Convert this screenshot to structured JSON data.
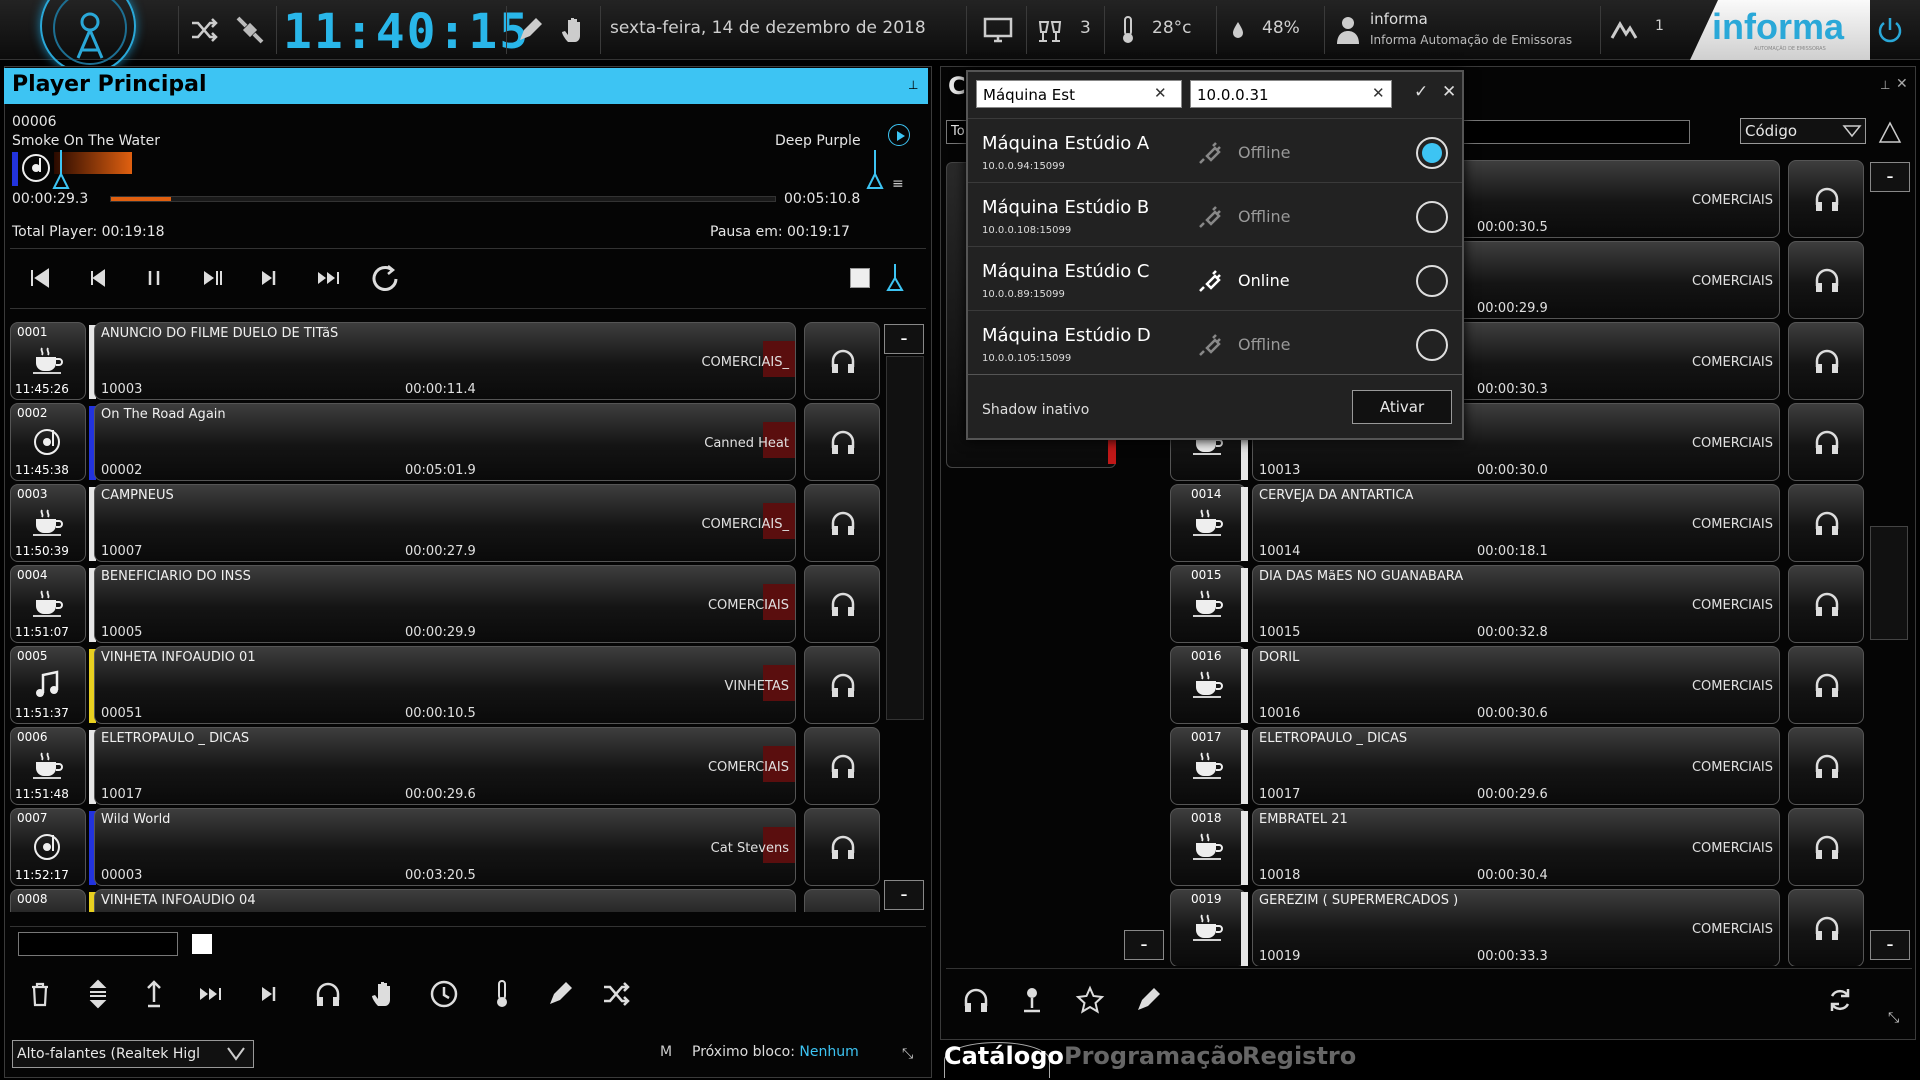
{
  "topbar": {
    "clock": "11:40:15",
    "date": "sexta-feira, 14 de dezembro de 2018",
    "alerts_count": "3",
    "temperature": "28°c",
    "humidity": "48%",
    "user_name": "informa",
    "user_company": "Informa Automação de Emissoras",
    "signal_count": "1",
    "brand_name": "informa",
    "brand_tagline": "AUTOMAÇÃO DE EMISSORAS"
  },
  "player": {
    "title": "Player Principal",
    "track_number": "00006",
    "track_title": "Smoke On The Water",
    "track_artist": "Deep Purple",
    "elapsed": "00:00:29.3",
    "remaining": "00:05:10.8",
    "total_label": "Total Player:",
    "total_value": "00:19:18",
    "pause_label": "Pausa em:",
    "pause_value": "00:19:17",
    "progress": 0.09
  },
  "queue": [
    {
      "num": "0001",
      "time": "11:45:26",
      "title": "ANUNCIO DO FILME DUELO DE TITãS",
      "code": "10003",
      "dur": "00:00:11.4",
      "cat": "COMERCIAIS_",
      "icon": "coffee",
      "bar": "#e6e6e6"
    },
    {
      "num": "0002",
      "time": "11:45:38",
      "title": "On The Road Again",
      "code": "00002",
      "dur": "00:05:01.9",
      "cat": "Canned Heat",
      "icon": "music-disc",
      "bar": "#2233dd"
    },
    {
      "num": "0003",
      "time": "11:50:39",
      "title": "CAMPNEUS",
      "code": "10007",
      "dur": "00:00:27.9",
      "cat": "COMERCIAIS_",
      "icon": "coffee",
      "bar": "#e6e6e6"
    },
    {
      "num": "0004",
      "time": "11:51:07",
      "title": "BENEFICIARIO DO INSS",
      "code": "10005",
      "dur": "00:00:29.9",
      "cat": "COMERCIAIS",
      "icon": "coffee",
      "bar": "#e6e6e6"
    },
    {
      "num": "0005",
      "time": "11:51:37",
      "title": "VINHETA INFOAUDIO 01",
      "code": "00051",
      "dur": "00:00:10.5",
      "cat": "VINHETAS",
      "icon": "music-note",
      "bar": "#e8d020"
    },
    {
      "num": "0006",
      "time": "11:51:48",
      "title": "ELETROPAULO _ DICAS",
      "code": "10017",
      "dur": "00:00:29.6",
      "cat": "COMERCIAIS",
      "icon": "coffee",
      "bar": "#e6e6e6"
    },
    {
      "num": "0007",
      "time": "11:52:17",
      "title": "Wild World",
      "code": "00003",
      "dur": "00:03:20.5",
      "cat": "Cat Stevens",
      "icon": "music-disc",
      "bar": "#2233dd"
    },
    {
      "num": "0008",
      "time": "",
      "title": "VINHETA INFOAUDIO 04",
      "code": "",
      "dur": "",
      "cat": "",
      "icon": "music-note",
      "bar": "#e8d020"
    }
  ],
  "footer": {
    "output_device": "Alto-falantes (Realtek Higl",
    "mode_letter": "M",
    "next_block_label": "Próximo bloco:",
    "next_block_value": "Nenhum"
  },
  "catalog": {
    "title_initial": "C",
    "search_prefix": "To",
    "sort_field": "Código",
    "items": [
      {
        "num": "",
        "code": "",
        "dur": "00:00:30.5",
        "title": "",
        "cat": "COMERCIAIS"
      },
      {
        "num": "",
        "code": "",
        "dur": "00:00:29.9",
        "title": "",
        "cat": "COMERCIAIS"
      },
      {
        "num": "",
        "code": "",
        "dur": "00:00:30.3",
        "title": "",
        "cat": "COMERCIAIS"
      },
      {
        "num": "",
        "code": "10013",
        "dur": "00:00:30.0",
        "title": "",
        "cat": "COMERCIAIS"
      },
      {
        "num": "0014",
        "code": "10014",
        "dur": "00:00:18.1",
        "title": "CERVEJA DA ANTARTICA",
        "cat": "COMERCIAIS"
      },
      {
        "num": "0015",
        "code": "10015",
        "dur": "00:00:32.8",
        "title": "DIA DAS MãES NO GUANABARA",
        "cat": "COMERCIAIS"
      },
      {
        "num": "0016",
        "code": "10016",
        "dur": "00:00:30.6",
        "title": "DORIL",
        "cat": "COMERCIAIS"
      },
      {
        "num": "0017",
        "code": "10017",
        "dur": "00:00:29.6",
        "title": "ELETROPAULO _ DICAS",
        "cat": "COMERCIAIS"
      },
      {
        "num": "0018",
        "code": "10018",
        "dur": "00:00:30.4",
        "title": "EMBRATEL 21",
        "cat": "COMERCIAIS"
      },
      {
        "num": "0019",
        "code": "10019",
        "dur": "00:00:33.3",
        "title": "GEREZIM ( SUPERMERCADOS )",
        "cat": "COMERCIAIS"
      }
    ]
  },
  "tabs": [
    "Catálogo",
    "Programação",
    "Registro"
  ],
  "machine_popup": {
    "name_value": "Máquina Est",
    "ip_value": "10.0.0.31",
    "machines": [
      {
        "name": "Máquina Estúdio A",
        "ip": "10.0.0.94:15099",
        "status": "Offline",
        "selected": true
      },
      {
        "name": "Máquina Estúdio B",
        "ip": "10.0.0.108:15099",
        "status": "Offline",
        "selected": false
      },
      {
        "name": "Máquina Estúdio C",
        "ip": "10.0.0.89:15099",
        "status": "Online",
        "selected": false
      },
      {
        "name": "Máquina Estúdio D",
        "ip": "10.0.0.105:15099",
        "status": "Offline",
        "selected": false
      }
    ],
    "shadow_status": "Shadow inativo",
    "activate_label": "Ativar"
  },
  "colors": {
    "accent": "#3dc4f3",
    "clock": "#29b6e9",
    "progress": "#e06010",
    "next_block": "#3dc4f3"
  }
}
